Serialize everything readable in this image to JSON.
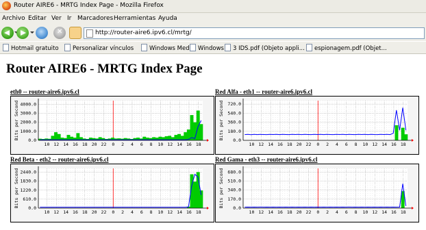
{
  "window": {
    "title": "Router AIRE6 - MRTG Index Page - Mozilla Firefox"
  },
  "menu": [
    "Archivo",
    "Editar",
    "Ver",
    "Ir",
    "Marcadores",
    "Herramientas",
    "Ayuda"
  ],
  "nav": {
    "url": "http://router-aire6.ipv6.cl/mrtg/"
  },
  "bookmarks": [
    "Hotmail gratuito",
    "Personalizar vínculos",
    "Windows Media",
    "Windows",
    "3 IDS.pdf (Objeto appli...",
    "espionagem.pdf (Objet..."
  ],
  "page": {
    "title": "Router AIRE6 - MRTG Index Page"
  },
  "graphs": [
    {
      "title": "eth0 -- router-aire6.ipv6.cl",
      "ylabel": "Bits per Second"
    },
    {
      "title": "Red Alfa - eth1 -- router-aire6.ipv6.cl",
      "ylabel": "Bits per Second"
    },
    {
      "title": "Red Beta - eth2 -- router-aire6.ipv6.cl",
      "ylabel": "Bits per Second"
    },
    {
      "title": "Red Gama - eth3 -- router-aire6.ipv6.cl",
      "ylabel": "Bits per Second"
    }
  ],
  "chart_data": [
    {
      "type": "area",
      "xticks": [
        "10",
        "12",
        "14",
        "16",
        "18",
        "20",
        "22",
        "0",
        "2",
        "4",
        "6",
        "8",
        "10",
        "12",
        "14",
        "16",
        "18"
      ],
      "yticks": [
        "0.0",
        "1000.0",
        "2000.0",
        "3000.0",
        "4000.0"
      ],
      "ylim": [
        0,
        4400
      ],
      "ylabel": "Bits per Second",
      "grid": true,
      "series": [
        {
          "color": "#00cc00",
          "values": [
            180,
            150,
            200,
            170,
            500,
            900,
            700,
            300,
            250,
            600,
            400,
            300,
            800,
            350,
            200,
            150,
            300,
            250,
            200,
            350,
            250,
            150,
            200,
            300,
            200,
            220,
            180,
            250,
            200,
            150,
            250,
            300,
            200,
            400,
            300,
            250,
            350,
            300,
            400,
            350,
            450,
            500,
            350,
            600,
            700,
            500,
            900,
            1200,
            2800,
            2000,
            3300,
            1800
          ]
        },
        {
          "color": "#0000ff",
          "values": [
            60,
            60,
            60,
            60,
            60,
            60,
            60,
            60,
            60,
            60,
            60,
            60,
            60,
            60,
            60,
            60,
            60,
            60,
            60,
            60,
            60,
            60,
            60,
            60,
            60,
            60,
            60,
            60,
            60,
            60,
            60,
            60,
            60,
            60,
            60,
            60,
            60,
            60,
            60,
            60,
            60,
            60,
            60,
            60,
            60,
            60,
            60,
            100,
            300,
            200,
            1500,
            2200
          ]
        }
      ]
    },
    {
      "type": "area",
      "xticks": [
        "10",
        "12",
        "14",
        "16",
        "18",
        "20",
        "22",
        "0",
        "2",
        "4",
        "6",
        "8",
        "10",
        "12",
        "14",
        "16",
        "18"
      ],
      "yticks": [
        "0.0",
        "180.0",
        "360.0",
        "540.0",
        "720.0"
      ],
      "ylim": [
        0,
        790
      ],
      "ylabel": "Bits per Second",
      "grid": true,
      "series": [
        {
          "color": "#00cc00",
          "values": [
            0,
            0,
            0,
            0,
            0,
            0,
            0,
            0,
            0,
            0,
            0,
            0,
            0,
            0,
            0,
            0,
            0,
            0,
            0,
            0,
            0,
            0,
            0,
            0,
            0,
            0,
            0,
            0,
            0,
            0,
            0,
            0,
            0,
            0,
            0,
            0,
            0,
            0,
            0,
            0,
            0,
            0,
            0,
            0,
            0,
            0,
            0,
            0,
            300,
            0,
            250,
            120
          ]
        },
        {
          "color": "#0000ff",
          "values": [
            115,
            118,
            112,
            120,
            115,
            118,
            116,
            114,
            118,
            116,
            120,
            115,
            118,
            116,
            114,
            118,
            116,
            120,
            115,
            118,
            116,
            114,
            118,
            116,
            120,
            115,
            118,
            116,
            114,
            118,
            116,
            120,
            115,
            118,
            116,
            114,
            118,
            116,
            120,
            115,
            118,
            116,
            114,
            118,
            116,
            120,
            115,
            140,
            600,
            200,
            650,
            200
          ]
        }
      ]
    },
    {
      "type": "area",
      "xticks": [
        "10",
        "12",
        "14",
        "16",
        "18",
        "20",
        "22",
        "0",
        "2",
        "4",
        "6",
        "8",
        "10",
        "12",
        "14",
        "16",
        "18"
      ],
      "yticks": [
        "0.0",
        "610.0",
        "1220.0",
        "1830.0",
        "2440.0"
      ],
      "ylim": [
        0,
        2700
      ],
      "ylabel": "Bits per Second",
      "grid": true,
      "series": [
        {
          "color": "#00cc00",
          "values": [
            0,
            0,
            0,
            0,
            0,
            0,
            0,
            0,
            0,
            0,
            0,
            0,
            0,
            0,
            0,
            0,
            0,
            0,
            0,
            0,
            0,
            0,
            0,
            0,
            0,
            0,
            0,
            0,
            0,
            0,
            0,
            0,
            0,
            0,
            0,
            0,
            0,
            0,
            0,
            0,
            0,
            0,
            0,
            0,
            0,
            0,
            0,
            100,
            2300,
            1800,
            2450,
            1200
          ]
        },
        {
          "color": "#0000ff",
          "values": [
            60,
            62,
            60,
            61,
            60,
            62,
            60,
            61,
            60,
            62,
            60,
            61,
            60,
            62,
            60,
            61,
            60,
            62,
            60,
            61,
            60,
            62,
            60,
            61,
            60,
            62,
            60,
            61,
            60,
            62,
            60,
            61,
            60,
            62,
            60,
            61,
            60,
            62,
            60,
            61,
            60,
            62,
            60,
            61,
            60,
            62,
            60,
            80,
            1500,
            2300,
            2100,
            900
          ]
        }
      ]
    },
    {
      "type": "area",
      "xticks": [
        "10",
        "12",
        "14",
        "16",
        "18",
        "20",
        "22",
        "0",
        "2",
        "4",
        "6",
        "8",
        "10",
        "12",
        "14",
        "16",
        "18"
      ],
      "yticks": [
        "0.0",
        "170.0",
        "340.0",
        "510.0",
        "680.0"
      ],
      "ylim": [
        0,
        750
      ],
      "ylabel": "Bits per Second",
      "grid": true,
      "series": [
        {
          "color": "#00cc00",
          "values": [
            0,
            0,
            0,
            0,
            0,
            0,
            0,
            0,
            0,
            0,
            0,
            0,
            0,
            0,
            0,
            0,
            0,
            0,
            0,
            0,
            0,
            0,
            0,
            0,
            0,
            0,
            0,
            0,
            0,
            0,
            0,
            0,
            0,
            0,
            0,
            0,
            0,
            0,
            0,
            0,
            0,
            0,
            0,
            0,
            0,
            0,
            0,
            0,
            0,
            0,
            320,
            0
          ]
        },
        {
          "color": "#0000ff",
          "values": [
            18,
            20,
            18,
            19,
            18,
            20,
            18,
            19,
            18,
            20,
            18,
            19,
            18,
            20,
            18,
            19,
            18,
            20,
            18,
            19,
            18,
            20,
            18,
            19,
            18,
            20,
            18,
            19,
            18,
            20,
            18,
            19,
            18,
            20,
            18,
            19,
            18,
            20,
            18,
            19,
            18,
            20,
            18,
            19,
            18,
            20,
            18,
            19,
            18,
            20,
            460,
            40
          ]
        }
      ]
    }
  ]
}
